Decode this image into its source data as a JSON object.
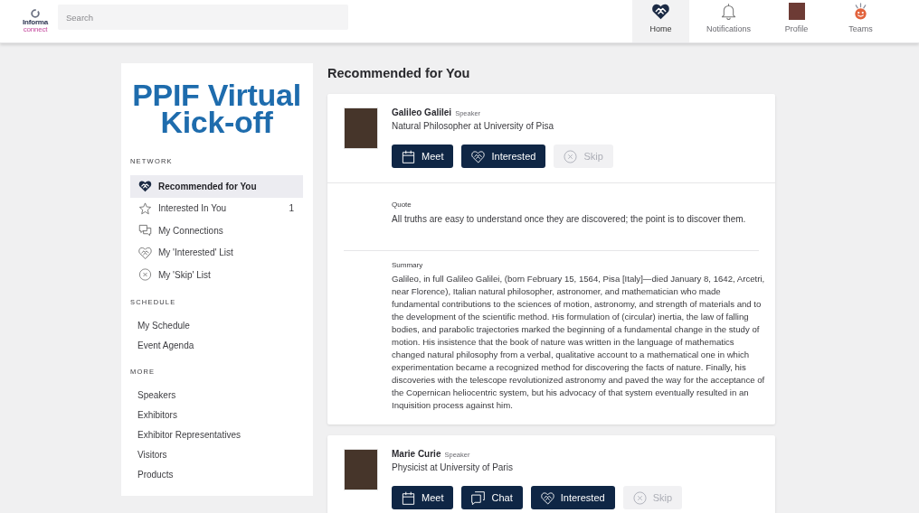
{
  "top_bar": {
    "logo": {
      "name": "Informa",
      "tagline": "connect"
    },
    "search": {
      "placeholder": "Search"
    },
    "nav": [
      {
        "kind": "home",
        "label": "Home",
        "selected": true
      },
      {
        "kind": "notifications",
        "label": "Notifications",
        "selected": false
      },
      {
        "kind": "profile",
        "label": "Profile",
        "selected": false
      },
      {
        "kind": "teams",
        "label": "Teams",
        "selected": false
      }
    ]
  },
  "sidebar": {
    "event_title": "PPIF Virtual Kick-off",
    "sections": [
      {
        "heading": "NETWORK",
        "items": [
          {
            "kind": "recommended",
            "label": "Recommended for You",
            "selected": true
          },
          {
            "kind": "incoming",
            "label": "Interested In You",
            "count": "1",
            "selected": false
          },
          {
            "kind": "connections",
            "label": "My Connections",
            "selected": false
          },
          {
            "kind": "interested",
            "label": "My 'Interested' List",
            "selected": false
          },
          {
            "kind": "skipped",
            "label": "My 'Skip' List",
            "selected": false
          }
        ]
      },
      {
        "heading": "SCHEDULE",
        "items": [
          {
            "label": "My Schedule",
            "selected": false
          },
          {
            "label": "Event Agenda",
            "selected": false
          }
        ]
      },
      {
        "heading": "MORE",
        "items": [
          {
            "label": "Speakers",
            "selected": false
          },
          {
            "label": "Exhibitors",
            "selected": false
          },
          {
            "label": "Exhibitor Representatives",
            "selected": false
          },
          {
            "label": "Visitors",
            "selected": false
          },
          {
            "label": "Products",
            "selected": false
          }
        ]
      }
    ]
  },
  "main": {
    "heading": "Recommended for You",
    "people": [
      {
        "name": "Galileo Galilei",
        "role": "Speaker",
        "title": "Natural Philosopher at University of Pisa",
        "actions": [
          {
            "kind": "meet",
            "label": "Meet"
          },
          {
            "kind": "interested",
            "label": "Interested"
          },
          {
            "kind": "skip",
            "label": "Skip"
          }
        ],
        "details": [
          {
            "label": "Quote",
            "text": "All truths are easy to understand once they are discovered; the point is to discover them."
          },
          {
            "label": "Summary",
            "text": "Galileo, in full Galileo Galilei, (born February 15, 1564, Pisa [Italy]—died January 8, 1642, Arcetri, near Florence), Italian natural philosopher, astronomer, and mathematician who made fundamental contributions to the sciences of motion, astronomy, and strength of materials and to the development of the scientific method. His formulation of (circular) inertia, the law of falling bodies, and parabolic trajectories marked the beginning of a fundamental change in the study of motion. His insistence that the book of nature was written in the language of mathematics changed natural philosophy from a verbal, qualitative account to a mathematical one in which experimentation became a recognized method for discovering the facts of nature. Finally, his discoveries with the telescope revolutionized astronomy and paved the way for the acceptance of the Copernican heliocentric system, but his advocacy of that system eventually resulted in an Inquisition process against him."
          }
        ]
      },
      {
        "name": "Marie Curie",
        "role": "Speaker",
        "title": "Physicist at University of Paris",
        "actions": [
          {
            "kind": "meet",
            "label": "Meet"
          },
          {
            "kind": "chat",
            "label": "Chat"
          },
          {
            "kind": "interested",
            "label": "Interested"
          },
          {
            "kind": "skip",
            "label": "Skip"
          }
        ]
      }
    ]
  }
}
